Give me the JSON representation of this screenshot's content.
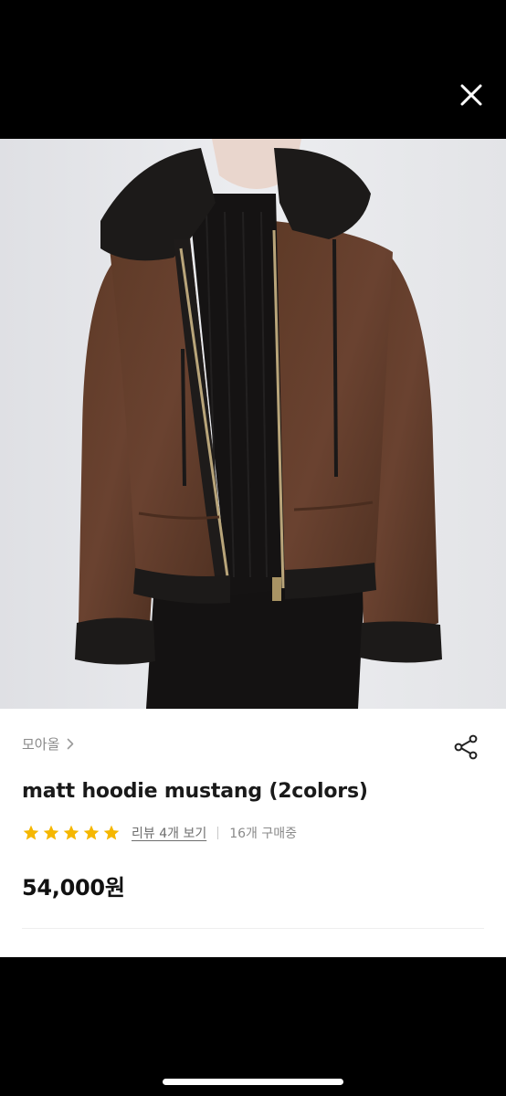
{
  "top_bar": {
    "close_icon": "close-icon",
    "close_color": "#ffffff"
  },
  "photo": {
    "description_icon": "product-photo",
    "jacket_color": "#5a3826",
    "fleece_color": "#1c1a19",
    "background_color": "#e6e7ea"
  },
  "product": {
    "seller": "모아올",
    "title": "matt hoodie mustang (2colors)",
    "rating": 5,
    "star_color": "#f5b700",
    "review_link": "리뷰 4개 보기",
    "purchase_count": "16개 구매중",
    "price": "54,000원"
  },
  "actions": {
    "share_icon": "share-icon"
  }
}
